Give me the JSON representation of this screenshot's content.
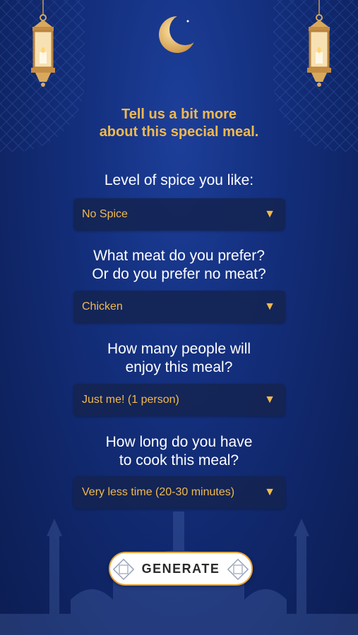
{
  "headline": [
    "Tell us a bit more",
    "about this special meal."
  ],
  "questions": [
    {
      "label": [
        "Level of spice you like:"
      ],
      "value": "No Spice"
    },
    {
      "label": [
        "What meat do you prefer?",
        "Or do you prefer no meat?"
      ],
      "value": "Chicken"
    },
    {
      "label": [
        "How many people will",
        "enjoy this meal?"
      ],
      "value": "Just me! (1 person)"
    },
    {
      "label": [
        "How long do you have",
        "to cook this meal?"
      ],
      "value": "Very less time (20-30 minutes)"
    }
  ],
  "generate_label": "GENERATE",
  "colors": {
    "accent": "#f2b94e",
    "background": "#14307f",
    "dropdown": "#142350"
  }
}
